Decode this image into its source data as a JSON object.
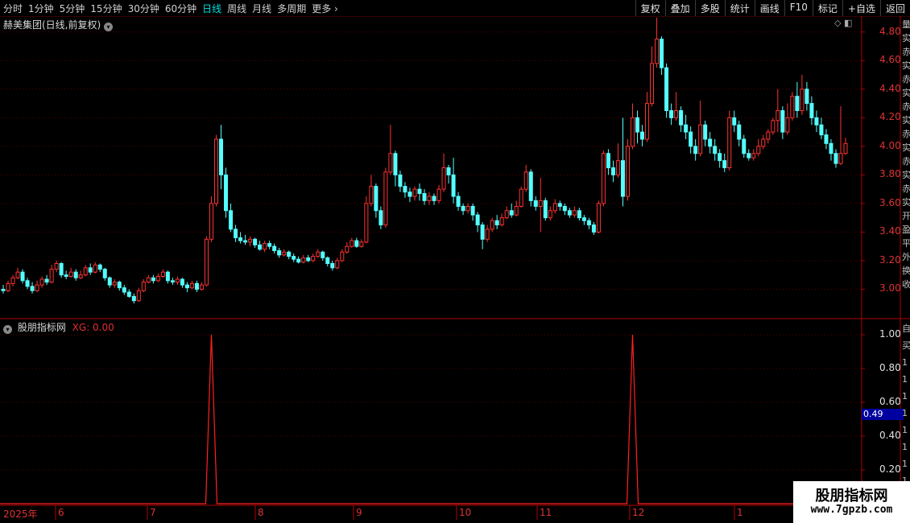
{
  "toolbar": {
    "periods": [
      "分时",
      "1分钟",
      "5分钟",
      "15分钟",
      "30分钟",
      "60分钟",
      "日线",
      "周线",
      "月线",
      "多周期",
      "更多"
    ],
    "active_period": "日线",
    "tools": [
      "复权",
      "叠加",
      "多股",
      "统计",
      "画线",
      "F10",
      "标记",
      "+自选",
      "返回"
    ]
  },
  "main_panel": {
    "title": "赫美集团(日线,前复权)",
    "price_ticks": [
      "4.80",
      "4.60",
      "4.40",
      "4.20",
      "4.00",
      "3.80",
      "3.60",
      "3.40",
      "3.20",
      "3.00"
    ]
  },
  "sub_panel": {
    "title": "股朋指标网",
    "xg_text": "XG: 0.00",
    "ticks": [
      "1.00",
      "0.80",
      "0.60",
      "0.40",
      "0.20"
    ],
    "cursor_value": "0.49"
  },
  "date_axis": [
    "2025年",
    "6",
    "7",
    "8",
    "9",
    "10",
    "11",
    "12",
    "1"
  ],
  "side_strip_top": [
    "量",
    "实",
    "赤",
    "实",
    "赤",
    "实",
    "赤",
    "实",
    "赤",
    "实",
    "赤",
    "实",
    "赤",
    "实",
    "开",
    "盈",
    "平",
    "外",
    "换",
    "收"
  ],
  "side_strip_bottom": [
    "自",
    "买",
    "1",
    "1",
    "1",
    "1",
    "1",
    "1",
    "1",
    "1"
  ],
  "watermark": {
    "line1": "股朋指标网",
    "line2": "www.7gpzb.com"
  },
  "colors": {
    "up": "#ff3232",
    "down": "#54ffff",
    "grid": "#5a0000",
    "signal": "#ff2020"
  },
  "chart_data": {
    "type": "candlestick",
    "y_range": [
      2.8,
      4.9
    ],
    "candles": [
      [
        3.0,
        2.99,
        3.03,
        2.97
      ],
      [
        2.99,
        3.04,
        3.06,
        2.98
      ],
      [
        3.04,
        3.08,
        3.1,
        3.02
      ],
      [
        3.08,
        3.12,
        3.15,
        3.07
      ],
      [
        3.12,
        3.06,
        3.14,
        3.04
      ],
      [
        3.06,
        3.02,
        3.08,
        3.0
      ],
      [
        3.02,
        2.99,
        3.05,
        2.97
      ],
      [
        2.99,
        3.03,
        3.06,
        2.98
      ],
      [
        3.03,
        3.07,
        3.09,
        3.01
      ],
      [
        3.07,
        3.05,
        3.1,
        3.03
      ],
      [
        3.05,
        3.14,
        3.17,
        3.04
      ],
      [
        3.14,
        3.18,
        3.2,
        3.12
      ],
      [
        3.18,
        3.1,
        3.19,
        3.08
      ],
      [
        3.1,
        3.09,
        3.13,
        3.07
      ],
      [
        3.09,
        3.12,
        3.15,
        3.08
      ],
      [
        3.12,
        3.08,
        3.14,
        3.06
      ],
      [
        3.08,
        3.1,
        3.13,
        3.07
      ],
      [
        3.1,
        3.15,
        3.17,
        3.09
      ],
      [
        3.15,
        3.12,
        3.18,
        3.1
      ],
      [
        3.12,
        3.17,
        3.19,
        3.11
      ],
      [
        3.17,
        3.14,
        3.18,
        3.12
      ],
      [
        3.14,
        3.08,
        3.15,
        3.06
      ],
      [
        3.08,
        3.03,
        3.09,
        3.01
      ],
      [
        3.03,
        3.05,
        3.07,
        3.01
      ],
      [
        3.05,
        3.01,
        3.06,
        2.99
      ],
      [
        3.01,
        2.98,
        3.03,
        2.96
      ],
      [
        2.98,
        2.95,
        3.0,
        2.94
      ],
      [
        2.95,
        2.92,
        2.97,
        2.9
      ],
      [
        2.92,
        2.99,
        3.01,
        2.91
      ],
      [
        2.99,
        3.05,
        3.07,
        2.98
      ],
      [
        3.05,
        3.08,
        3.1,
        3.04
      ],
      [
        3.08,
        3.06,
        3.1,
        3.04
      ],
      [
        3.06,
        3.09,
        3.11,
        3.05
      ],
      [
        3.09,
        3.12,
        3.14,
        3.08
      ],
      [
        3.12,
        3.06,
        3.13,
        3.04
      ],
      [
        3.06,
        3.05,
        3.08,
        3.03
      ],
      [
        3.05,
        3.07,
        3.09,
        3.03
      ],
      [
        3.07,
        3.03,
        3.08,
        3.01
      ],
      [
        3.03,
        3.01,
        3.05,
        2.98
      ],
      [
        3.01,
        3.04,
        3.06,
        3.0
      ],
      [
        3.04,
        3.0,
        3.06,
        2.98
      ],
      [
        3.0,
        3.03,
        3.05,
        2.99
      ],
      [
        3.03,
        3.35,
        3.37,
        3.02
      ],
      [
        3.35,
        3.6,
        3.65,
        3.33
      ],
      [
        3.6,
        4.05,
        4.08,
        3.58
      ],
      [
        4.05,
        3.8,
        4.15,
        3.7
      ],
      [
        3.8,
        3.55,
        3.85,
        3.5
      ],
      [
        3.55,
        3.42,
        3.6,
        3.4
      ],
      [
        3.42,
        3.36,
        3.45,
        3.33
      ],
      [
        3.36,
        3.34,
        3.4,
        3.32
      ],
      [
        3.34,
        3.33,
        3.38,
        3.31
      ],
      [
        3.33,
        3.35,
        3.37,
        3.3
      ],
      [
        3.35,
        3.31,
        3.36,
        3.29
      ],
      [
        3.31,
        3.28,
        3.34,
        3.27
      ],
      [
        3.28,
        3.32,
        3.34,
        3.26
      ],
      [
        3.32,
        3.3,
        3.34,
        3.28
      ],
      [
        3.3,
        3.27,
        3.32,
        3.25
      ],
      [
        3.27,
        3.24,
        3.29,
        3.22
      ],
      [
        3.24,
        3.26,
        3.28,
        3.23
      ],
      [
        3.26,
        3.23,
        3.27,
        3.21
      ],
      [
        3.23,
        3.21,
        3.25,
        3.19
      ],
      [
        3.21,
        3.19,
        3.23,
        3.18
      ],
      [
        3.19,
        3.22,
        3.24,
        3.18
      ],
      [
        3.22,
        3.2,
        3.24,
        3.19
      ],
      [
        3.2,
        3.23,
        3.25,
        3.19
      ],
      [
        3.23,
        3.26,
        3.28,
        3.22
      ],
      [
        3.26,
        3.22,
        3.27,
        3.2
      ],
      [
        3.22,
        3.18,
        3.23,
        3.16
      ],
      [
        3.18,
        3.15,
        3.2,
        3.13
      ],
      [
        3.15,
        3.2,
        3.22,
        3.14
      ],
      [
        3.2,
        3.26,
        3.28,
        3.19
      ],
      [
        3.26,
        3.3,
        3.33,
        3.25
      ],
      [
        3.3,
        3.34,
        3.36,
        3.29
      ],
      [
        3.34,
        3.3,
        3.36,
        3.29
      ],
      [
        3.3,
        3.33,
        3.35,
        3.29
      ],
      [
        3.33,
        3.6,
        3.65,
        3.32
      ],
      [
        3.6,
        3.72,
        3.8,
        3.58
      ],
      [
        3.72,
        3.55,
        3.74,
        3.5
      ],
      [
        3.55,
        3.45,
        3.58,
        3.42
      ],
      [
        3.45,
        3.82,
        3.85,
        3.43
      ],
      [
        3.82,
        3.95,
        4.15,
        3.8
      ],
      [
        3.95,
        3.8,
        3.97,
        3.72
      ],
      [
        3.8,
        3.72,
        3.83,
        3.68
      ],
      [
        3.72,
        3.68,
        3.75,
        3.64
      ],
      [
        3.68,
        3.65,
        3.71,
        3.61
      ],
      [
        3.65,
        3.7,
        3.72,
        3.62
      ],
      [
        3.7,
        3.67,
        3.74,
        3.62
      ],
      [
        3.67,
        3.62,
        3.7,
        3.59
      ],
      [
        3.62,
        3.65,
        3.68,
        3.59
      ],
      [
        3.65,
        3.62,
        3.67,
        3.59
      ],
      [
        3.62,
        3.7,
        3.73,
        3.6
      ],
      [
        3.7,
        3.85,
        3.95,
        3.68
      ],
      [
        3.85,
        3.8,
        3.87,
        3.74
      ],
      [
        3.8,
        3.65,
        3.92,
        3.6
      ],
      [
        3.65,
        3.58,
        3.68,
        3.55
      ],
      [
        3.58,
        3.55,
        3.6,
        3.52
      ],
      [
        3.55,
        3.58,
        3.6,
        3.53
      ],
      [
        3.58,
        3.52,
        3.6,
        3.48
      ],
      [
        3.52,
        3.45,
        3.54,
        3.4
      ],
      [
        3.45,
        3.35,
        3.47,
        3.28
      ],
      [
        3.35,
        3.42,
        3.45,
        3.33
      ],
      [
        3.42,
        3.48,
        3.5,
        3.4
      ],
      [
        3.48,
        3.45,
        3.52,
        3.42
      ],
      [
        3.45,
        3.5,
        3.53,
        3.44
      ],
      [
        3.5,
        3.55,
        3.58,
        3.49
      ],
      [
        3.55,
        3.52,
        3.6,
        3.5
      ],
      [
        3.52,
        3.58,
        3.62,
        3.51
      ],
      [
        3.58,
        3.7,
        3.72,
        3.57
      ],
      [
        3.7,
        3.82,
        3.87,
        3.68
      ],
      [
        3.82,
        3.62,
        3.84,
        3.58
      ],
      [
        3.62,
        3.58,
        3.65,
        3.55
      ],
      [
        3.58,
        3.62,
        3.78,
        3.4
      ],
      [
        3.62,
        3.5,
        3.64,
        3.48
      ],
      [
        3.5,
        3.55,
        3.58,
        3.48
      ],
      [
        3.55,
        3.6,
        3.63,
        3.53
      ],
      [
        3.6,
        3.58,
        3.62,
        3.55
      ],
      [
        3.58,
        3.55,
        3.6,
        3.52
      ],
      [
        3.55,
        3.52,
        3.57,
        3.5
      ],
      [
        3.52,
        3.55,
        3.58,
        3.5
      ],
      [
        3.55,
        3.5,
        3.57,
        3.48
      ],
      [
        3.5,
        3.48,
        3.52,
        3.45
      ],
      [
        3.48,
        3.45,
        3.5,
        3.42
      ],
      [
        3.45,
        3.4,
        3.47,
        3.38
      ],
      [
        3.4,
        3.6,
        3.62,
        3.39
      ],
      [
        3.6,
        3.95,
        3.97,
        3.58
      ],
      [
        3.95,
        3.85,
        3.98,
        3.8
      ],
      [
        3.85,
        3.8,
        3.9,
        3.75
      ],
      [
        3.8,
        3.9,
        4.02,
        3.78
      ],
      [
        3.9,
        3.65,
        4.2,
        3.58
      ],
      [
        3.65,
        4.0,
        4.05,
        3.62
      ],
      [
        4.0,
        4.2,
        4.3,
        3.98
      ],
      [
        4.2,
        4.1,
        4.25,
        4.02
      ],
      [
        4.1,
        4.05,
        4.15,
        4.0
      ],
      [
        4.05,
        4.3,
        4.38,
        4.03
      ],
      [
        4.3,
        4.58,
        4.7,
        4.28
      ],
      [
        4.58,
        4.75,
        4.9,
        4.55
      ],
      [
        4.75,
        4.55,
        4.77,
        4.5
      ],
      [
        4.55,
        4.25,
        4.58,
        4.2
      ],
      [
        4.25,
        4.2,
        4.3,
        4.15
      ],
      [
        4.2,
        4.25,
        4.38,
        4.18
      ],
      [
        4.25,
        4.15,
        4.28,
        4.1
      ],
      [
        4.15,
        4.1,
        4.22,
        4.05
      ],
      [
        4.1,
        4.0,
        4.14,
        3.95
      ],
      [
        4.0,
        3.95,
        4.05,
        3.9
      ],
      [
        3.95,
        4.15,
        4.32,
        3.93
      ],
      [
        4.15,
        4.05,
        4.18,
        4.0
      ],
      [
        4.05,
        4.0,
        4.1,
        3.95
      ],
      [
        4.0,
        3.95,
        4.05,
        3.9
      ],
      [
        3.95,
        3.9,
        3.98,
        3.85
      ],
      [
        3.9,
        3.85,
        3.95,
        3.82
      ],
      [
        3.85,
        4.2,
        4.25,
        3.83
      ],
      [
        4.2,
        4.15,
        4.25,
        4.1
      ],
      [
        4.15,
        4.05,
        4.18,
        4.0
      ],
      [
        4.05,
        3.95,
        4.08,
        3.92
      ],
      [
        3.95,
        3.92,
        3.98,
        3.9
      ],
      [
        3.92,
        3.95,
        3.98,
        3.9
      ],
      [
        3.95,
        4.0,
        4.05,
        3.93
      ],
      [
        4.0,
        4.05,
        4.08,
        3.98
      ],
      [
        4.05,
        4.1,
        4.12,
        4.02
      ],
      [
        4.1,
        4.18,
        4.2,
        4.08
      ],
      [
        4.18,
        4.25,
        4.4,
        4.1
      ],
      [
        4.25,
        4.1,
        4.28,
        4.05
      ],
      [
        4.1,
        4.2,
        4.3,
        4.08
      ],
      [
        4.2,
        4.35,
        4.38,
        4.18
      ],
      [
        4.35,
        4.25,
        4.45,
        4.2
      ],
      [
        4.25,
        4.4,
        4.5,
        4.22
      ],
      [
        4.4,
        4.3,
        4.45,
        4.25
      ],
      [
        4.3,
        4.2,
        4.35,
        4.15
      ],
      [
        4.2,
        4.15,
        4.25,
        4.1
      ],
      [
        4.15,
        4.08,
        4.2,
        4.05
      ],
      [
        4.08,
        4.02,
        4.12,
        3.98
      ],
      [
        4.02,
        3.95,
        4.05,
        3.9
      ],
      [
        3.95,
        3.88,
        3.98,
        3.85
      ],
      [
        3.88,
        3.95,
        4.28,
        3.87
      ],
      [
        3.95,
        4.02,
        4.06,
        3.94
      ]
    ],
    "signal": {
      "peak_indices": [
        43,
        130
      ],
      "peak_value": 1.0,
      "base_value": 0.0
    }
  }
}
